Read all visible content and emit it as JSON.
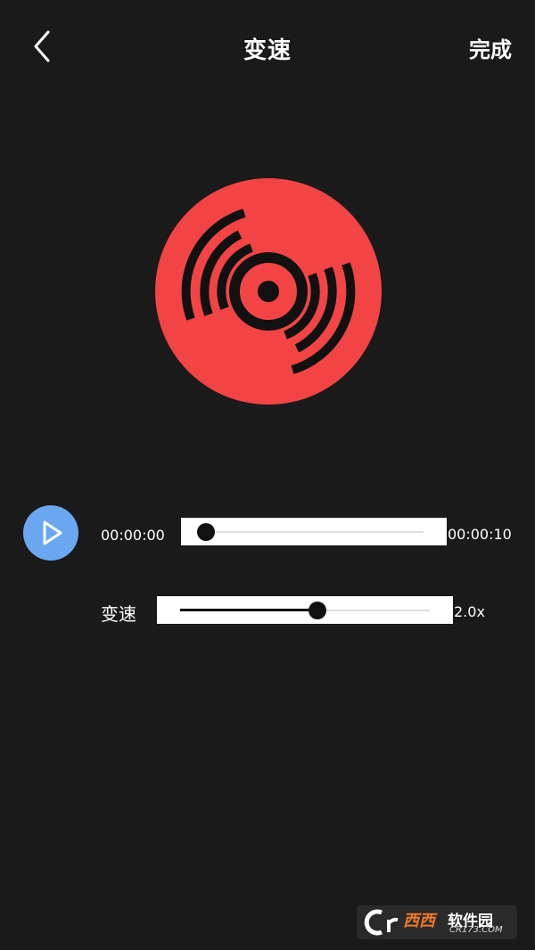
{
  "header": {
    "back_icon": "chevron-left-icon",
    "title": "变速",
    "done_label": "完成"
  },
  "disc": {
    "icon": "music-disc-icon",
    "color": "#f24444"
  },
  "player": {
    "play_icon": "play-icon",
    "play_color": "#6aa7f0",
    "current_time": "00:00:00",
    "total_time": "00:00:10",
    "progress": 0.0
  },
  "speed": {
    "label": "变速",
    "value_text": "2.0x",
    "level": 0.55
  },
  "watermark": {
    "brand": "西西",
    "name": "软件园",
    "url": "CR173.COM"
  }
}
